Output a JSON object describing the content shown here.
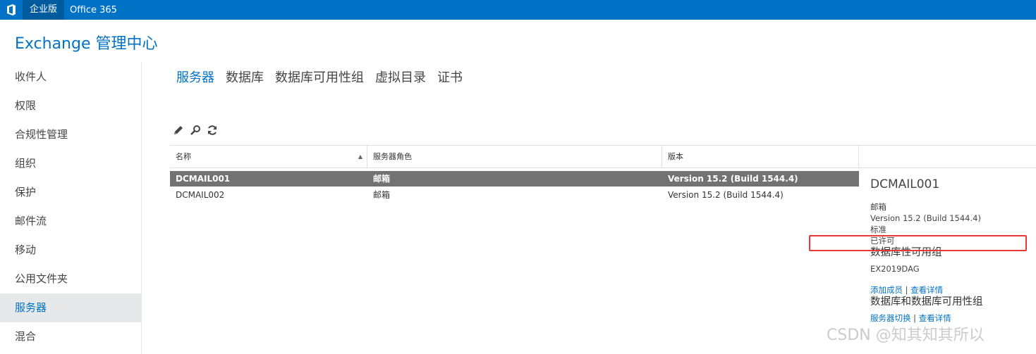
{
  "topbar": {
    "edition_label": "企业版",
    "product_label": "Office 365"
  },
  "app": {
    "title": "Exchange 管理中心"
  },
  "sidebar": {
    "items": [
      {
        "label": "收件人"
      },
      {
        "label": "权限"
      },
      {
        "label": "合规性管理"
      },
      {
        "label": "组织"
      },
      {
        "label": "保护"
      },
      {
        "label": "邮件流"
      },
      {
        "label": "移动"
      },
      {
        "label": "公用文件夹"
      },
      {
        "label": "服务器",
        "active": true
      },
      {
        "label": "混合"
      }
    ]
  },
  "tabs": [
    {
      "label": "服务器",
      "active": true
    },
    {
      "label": "数据库"
    },
    {
      "label": "数据库可用性组"
    },
    {
      "label": "虚拟目录"
    },
    {
      "label": "证书"
    }
  ],
  "toolbar": {
    "icons": [
      "edit-icon",
      "search-icon",
      "refresh-icon"
    ]
  },
  "grid": {
    "columns": [
      "名称",
      "服务器角色",
      "版本"
    ],
    "sort_indicator": "▲",
    "rows": [
      {
        "name": "DCMAIL001",
        "role": "邮箱",
        "version": "Version 15.2 (Build 1544.4)",
        "selected": true
      },
      {
        "name": "DCMAIL002",
        "role": "邮箱",
        "version": "Version 15.2 (Build 1544.4)"
      }
    ]
  },
  "details": {
    "title": "DCMAIL001",
    "role": "邮箱",
    "version": "Version 15.2 (Build 1544.4)",
    "edition": "标准",
    "license": "已许可",
    "dag_heading": "数据库性可用组",
    "dag_value": "EX2019DAG",
    "dag_links": {
      "add_member": "添加成员",
      "separator": "|",
      "view_details": "查看详情"
    },
    "db_heading": "数据库和数据库可用性组",
    "db_links": {
      "switchover": "服务器切换",
      "separator": "|",
      "view_details": "查看详情"
    }
  },
  "watermark": "CSDN @知其知其所以",
  "colors": {
    "brand": "#0072c6",
    "selected_row": "#727272",
    "highlight": "#e53935"
  }
}
